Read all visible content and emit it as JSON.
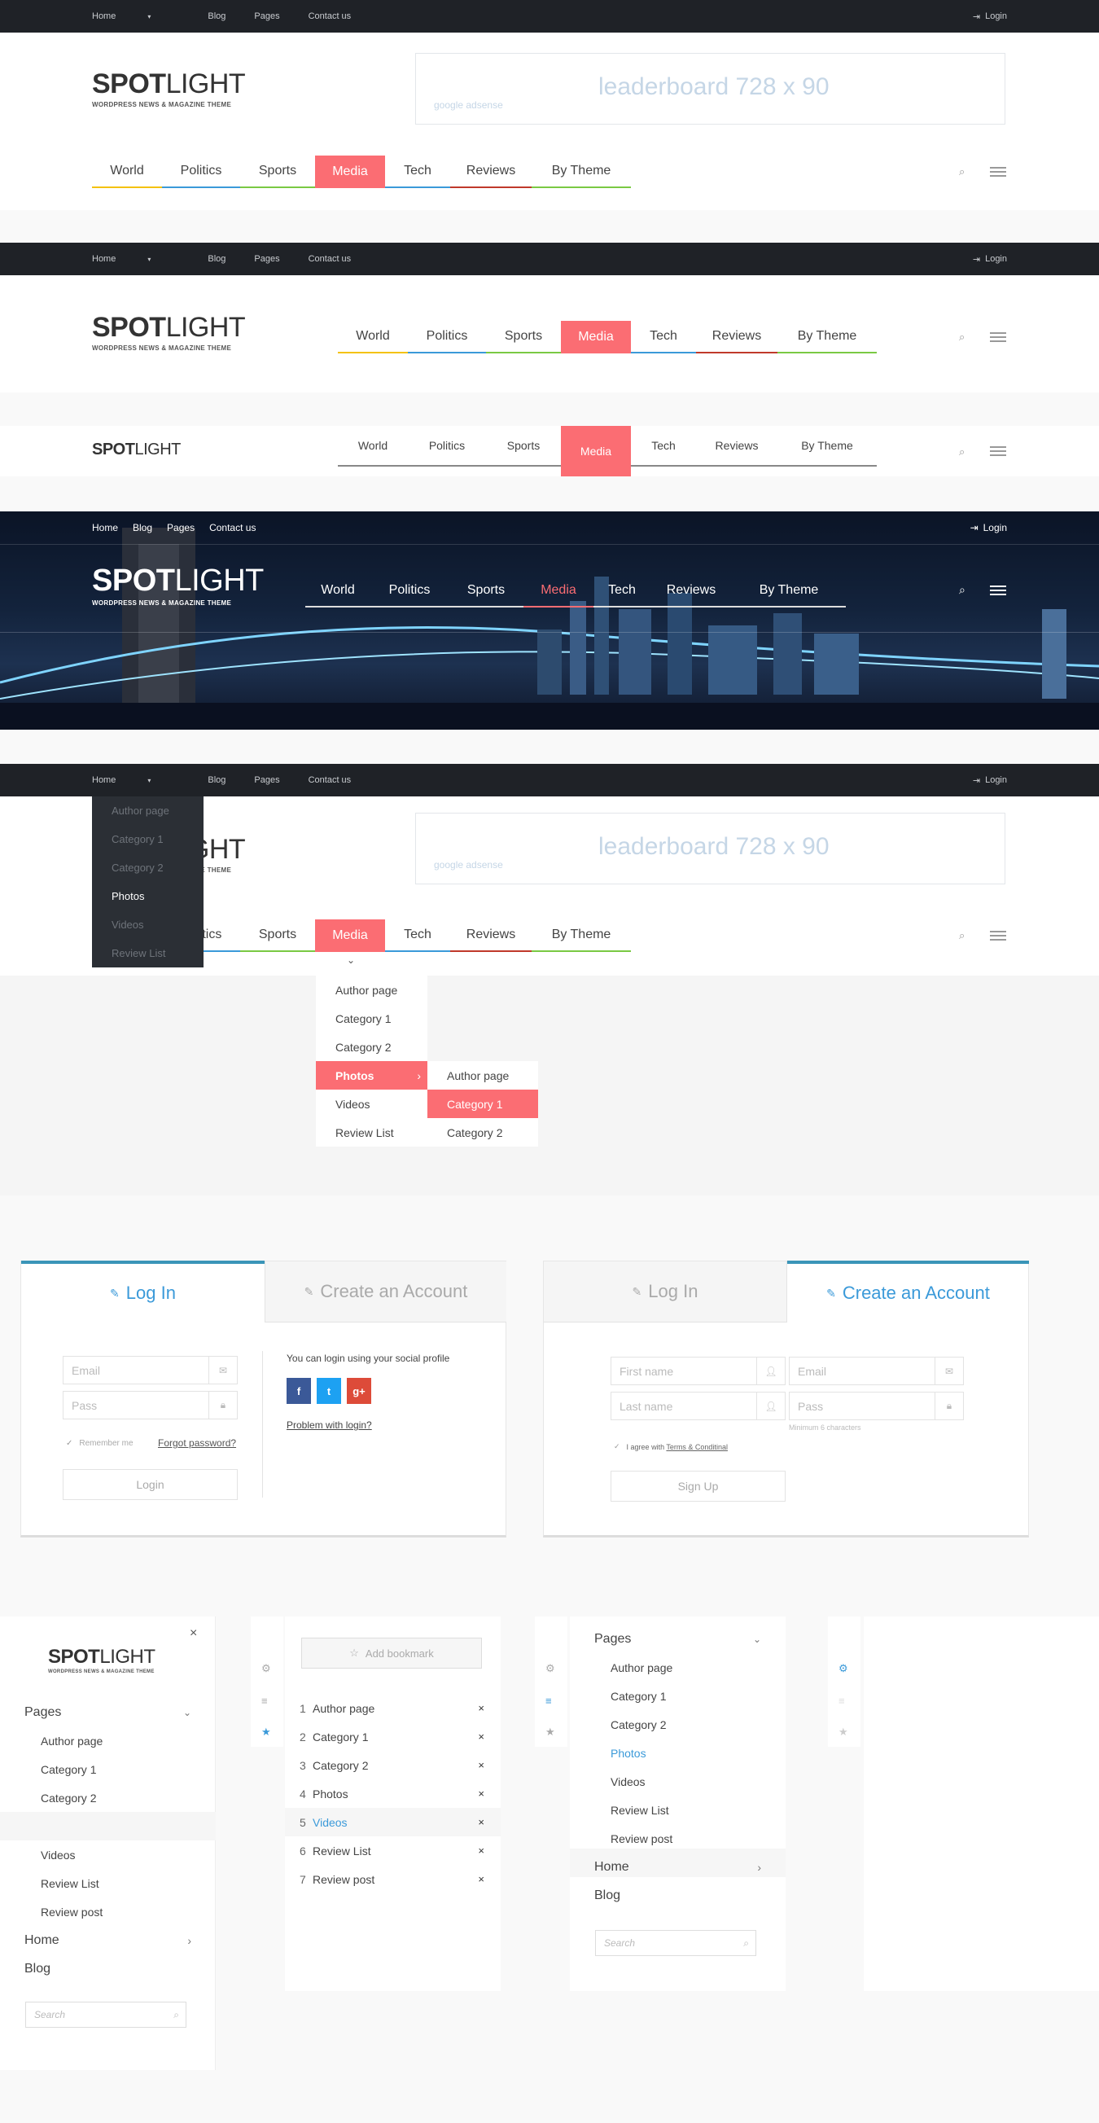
{
  "topbar": {
    "home": "Home",
    "blog": "Blog",
    "pages": "Pages",
    "contact": "Contact us",
    "login": "Login"
  },
  "logo": {
    "bold": "SPOT",
    "light": "LIGHT",
    "tagline": "WORDPRESS NEWS & MAGAZINE THEME"
  },
  "ad": {
    "text": "leaderboard    728 x 90",
    "source": "google adsense"
  },
  "nav": {
    "items": [
      "World",
      "Politics",
      "Sports",
      "Media",
      "Tech",
      "Reviews",
      "By Theme"
    ],
    "active": "Media",
    "colors": [
      "#f4c20d",
      "#3b9ad9",
      "#7ac943",
      "#fb6d73",
      "#3b9ad9",
      "#c0392b",
      "#7ac943"
    ]
  },
  "dark_nav": {
    "top": [
      "Home",
      "Blog",
      "Pages",
      "Contact us"
    ],
    "login": "Login"
  },
  "pages_dropdown": [
    "Author page",
    "Category 1",
    "Category 2",
    "Photos",
    "Videos",
    "Review List"
  ],
  "media_dropdown": [
    "Author page",
    "Category 1",
    "Category 2",
    "Photos",
    "Videos",
    "Review List"
  ],
  "photos_submenu": [
    "Author page",
    "Category 1",
    "Category 2"
  ],
  "login_panel": {
    "tab_login": "Log In",
    "tab_create": "Create an Account",
    "email": "Email",
    "pass": "Pass",
    "remember": "Remember me",
    "forgot": "Forgot  password?",
    "login_btn": "Login",
    "social_text": "You can login using your social profile",
    "social": [
      "f",
      "t",
      "g+"
    ],
    "problem": "Problem with login?"
  },
  "create_panel": {
    "tab_login": "Log In",
    "tab_create": "Create an Account",
    "first": "First name",
    "email": "Email",
    "last": "Last name",
    "pass": "Pass",
    "min": "Minimum 6 characters",
    "agree_pre": "I agree with ",
    "agree_link": "Terms & Conditinal",
    "signup": "Sign Up"
  },
  "mobile_menu": {
    "pages": "Pages",
    "items": [
      "Author page",
      "Category 1",
      "Category 2",
      "Photos",
      "Videos",
      "Review List",
      "Review post"
    ],
    "home": "Home",
    "blog": "Blog",
    "search": "Search"
  },
  "bookmarks": {
    "add": "Add bookmark",
    "items": [
      "Author page",
      "Category 1",
      "Category 2",
      "Photos",
      "Videos",
      "Review List",
      "Review post"
    ],
    "active_index": 4
  }
}
